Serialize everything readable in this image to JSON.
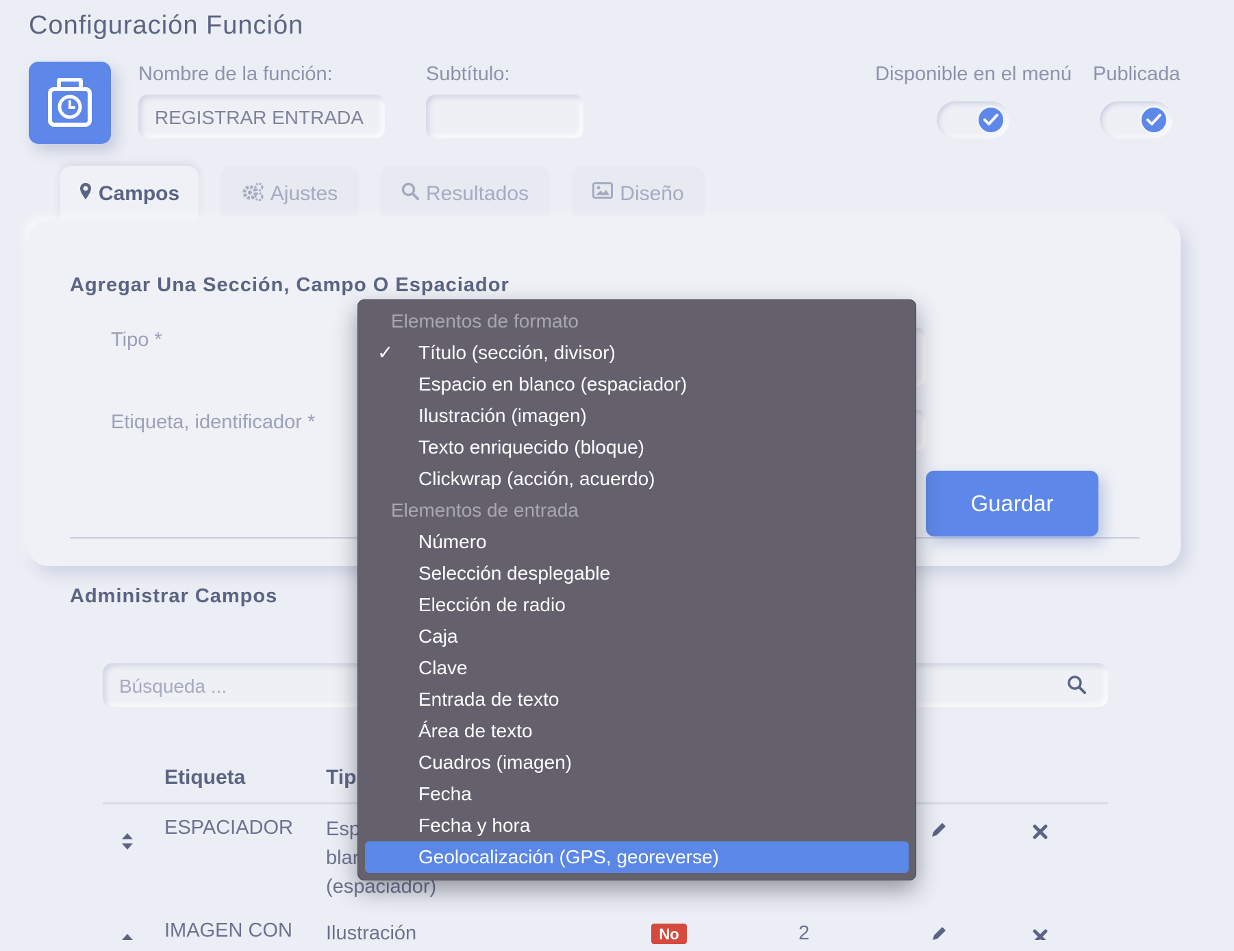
{
  "page": {
    "title": "Configuración Función"
  },
  "function": {
    "name_label": "Nombre de la función:",
    "name_value": "REGISTRAR ENTRADA",
    "subtitle_label": "Subtítulo:",
    "subtitle_value": "",
    "menu_label": "Disponible en el menú",
    "menu_on": true,
    "published_label": "Publicada",
    "published_on": true
  },
  "tabs": [
    {
      "label": "Campos",
      "icon": "map-marker-icon",
      "active": true
    },
    {
      "label": "Ajustes",
      "icon": "gears-icon",
      "active": false
    },
    {
      "label": "Resultados",
      "icon": "search-icon",
      "active": false
    },
    {
      "label": "Diseño",
      "icon": "image-icon",
      "active": false
    }
  ],
  "add_section": {
    "title": "Agregar Una Sección, Campo O Espaciador",
    "type_label": "Tipo *",
    "tag_label": "Etiqueta, identificador *",
    "save_label": "Guardar"
  },
  "manage": {
    "title": "Administrar Campos",
    "search_placeholder": "Búsqueda ...",
    "columns": [
      "Etiqueta",
      "Tip"
    ],
    "rows": [
      {
        "label": "ESPACIADOR",
        "type_lines": [
          "Esp",
          "blar",
          "(espaciador)"
        ]
      },
      {
        "label": "IMAGEN CON",
        "type": "Ilustración",
        "badge": "No",
        "count": "2"
      }
    ]
  },
  "dropdown": {
    "groups": [
      {
        "label": "Elementos de formato",
        "options": [
          {
            "label": "Título (sección, divisor)",
            "checked": true
          },
          {
            "label": "Espacio en blanco (espaciador)"
          },
          {
            "label": "Ilustración (imagen)"
          },
          {
            "label": "Texto enriquecido (bloque)"
          },
          {
            "label": "Clickwrap (acción, acuerdo)"
          }
        ]
      },
      {
        "label": "Elementos de entrada",
        "options": [
          {
            "label": "Número"
          },
          {
            "label": "Selección desplegable"
          },
          {
            "label": "Elección de radio"
          },
          {
            "label": "Caja"
          },
          {
            "label": "Clave"
          },
          {
            "label": "Entrada de texto"
          },
          {
            "label": "Área de texto"
          },
          {
            "label": "Cuadros (imagen)"
          },
          {
            "label": "Fecha"
          },
          {
            "label": "Fecha y hora"
          },
          {
            "label": "Geolocalización (GPS, georeverse)",
            "highlighted": true
          }
        ]
      }
    ],
    "check_mark": "✓"
  },
  "colors": {
    "accent": "#5d87e8",
    "background": "#eceef5",
    "menu_bg": "#64616d",
    "badge_red": "#d64a3e"
  }
}
